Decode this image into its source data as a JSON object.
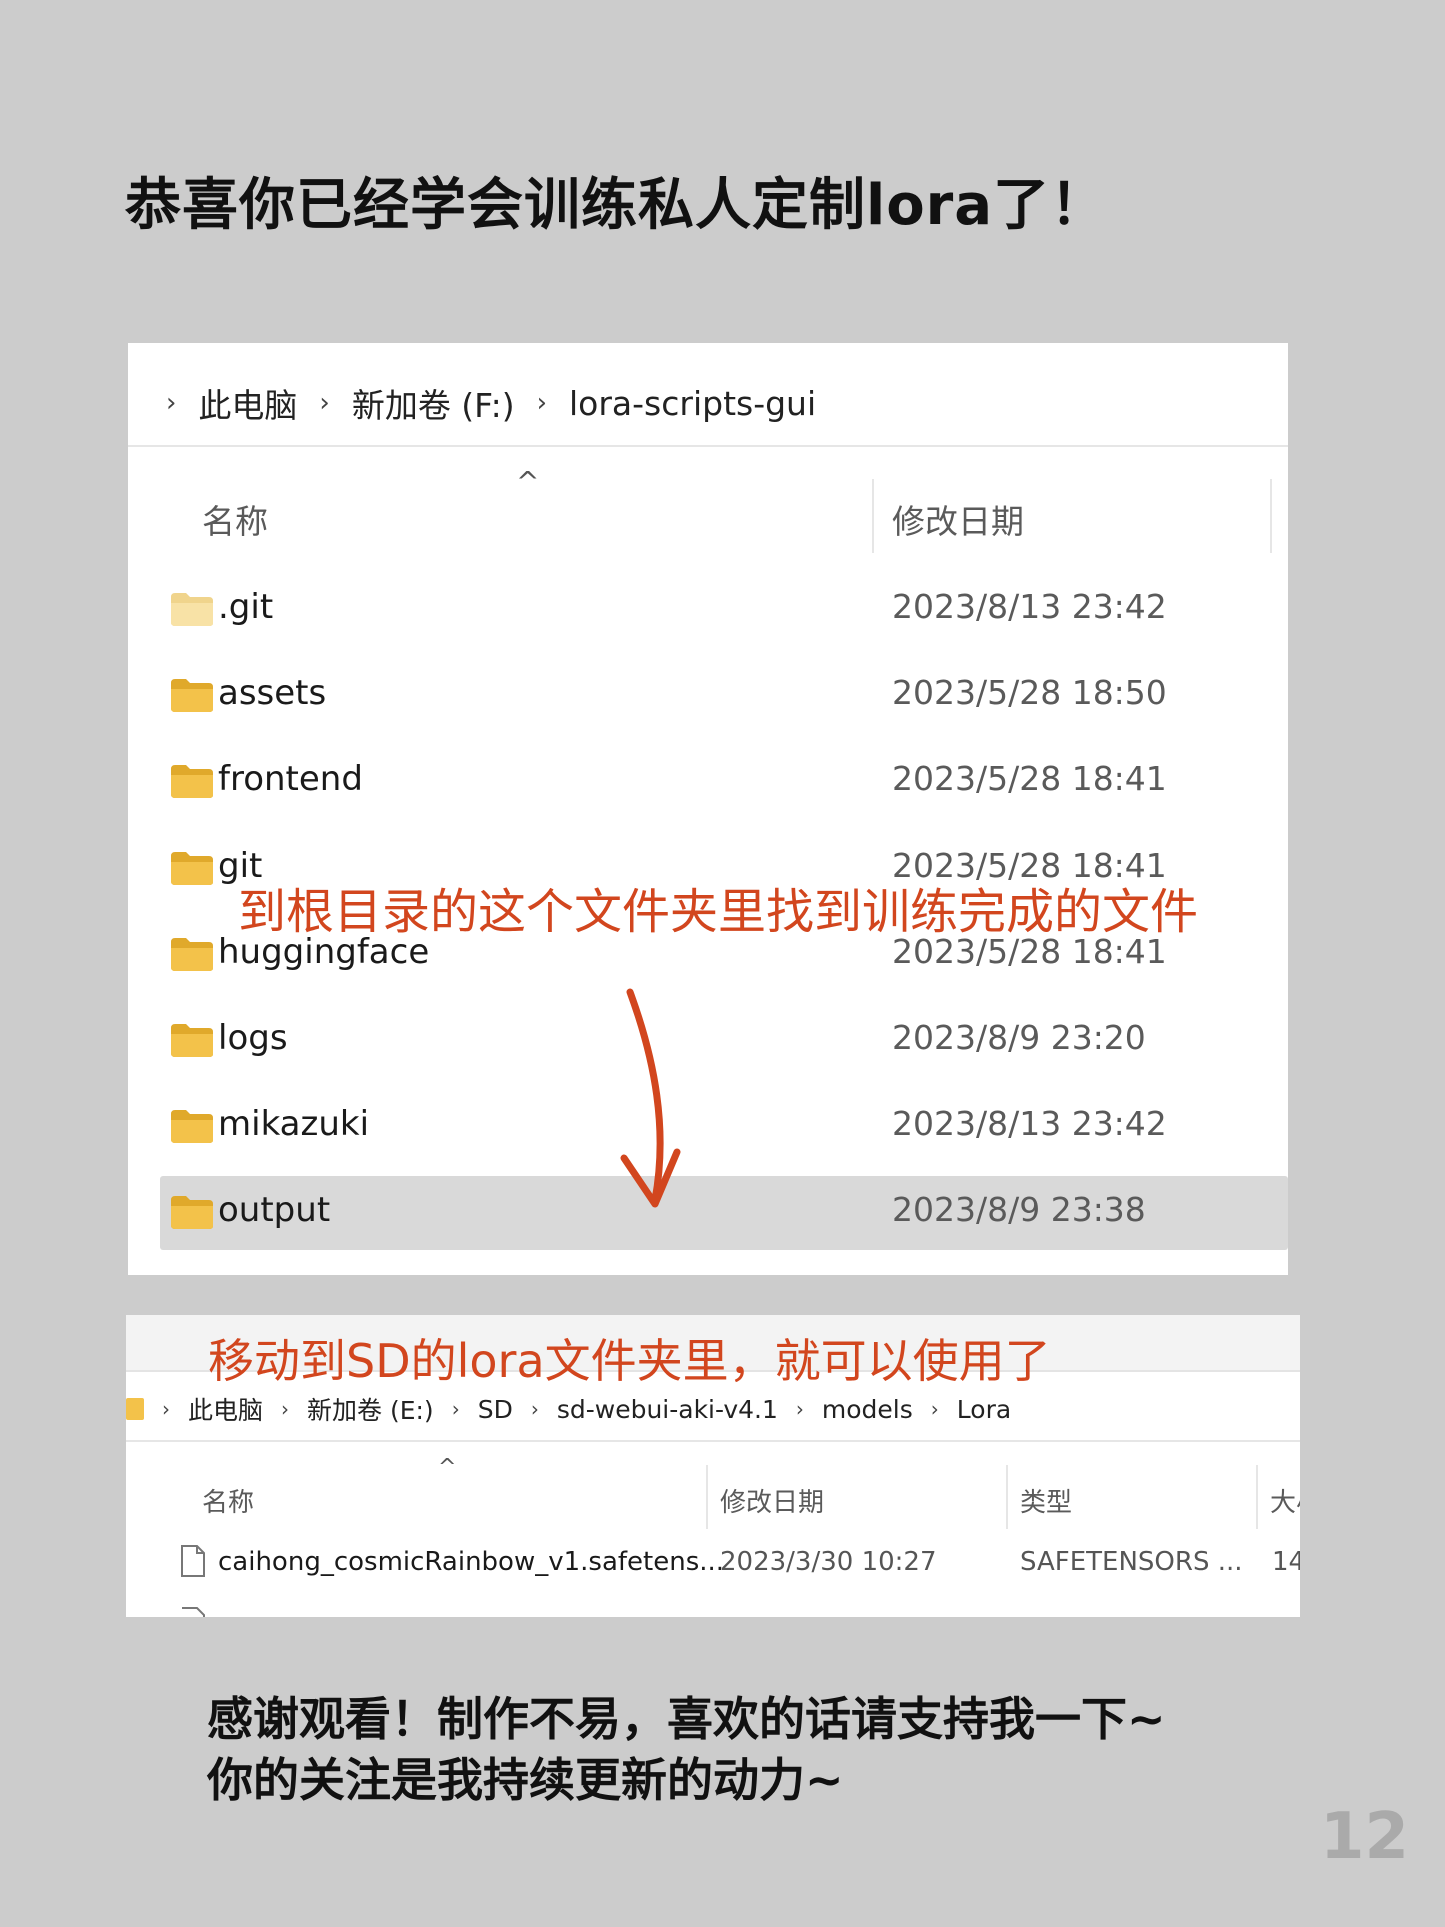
{
  "title": "恭喜你已经学会训练私人定制lora了！",
  "explorer1": {
    "breadcrumb": [
      "此电脑",
      "新加卷 (F:)",
      "lora-scripts-gui"
    ],
    "columns": {
      "name": "名称",
      "modified": "修改日期"
    },
    "rows": [
      {
        "name": ".git",
        "date": "2023/8/13 23:42",
        "selected": false,
        "faded": true
      },
      {
        "name": "assets",
        "date": "2023/5/28 18:50",
        "selected": false,
        "faded": false
      },
      {
        "name": "frontend",
        "date": "2023/5/28 18:41",
        "selected": false,
        "faded": false
      },
      {
        "name": "git",
        "date": "2023/5/28 18:41",
        "selected": false,
        "faded": false
      },
      {
        "name": "huggingface",
        "date": "2023/5/28 18:41",
        "selected": false,
        "faded": false
      },
      {
        "name": "logs",
        "date": "2023/8/9 23:20",
        "selected": false,
        "faded": false
      },
      {
        "name": "mikazuki",
        "date": "2023/8/13 23:42",
        "selected": false,
        "faded": false
      },
      {
        "name": "output",
        "date": "2023/8/9 23:38",
        "selected": true,
        "faded": false
      }
    ]
  },
  "annotation1": "到根目录的这个文件夹里找到训练完成的文件",
  "annotation2": "移动到SD的lora文件夹里，就可以使用了",
  "explorer2": {
    "breadcrumb": [
      "此电脑",
      "新加卷 (E:)",
      "SD",
      "sd-webui-aki-v4.1",
      "models",
      "Lora"
    ],
    "columns": {
      "name": "名称",
      "modified": "修改日期",
      "type": "类型",
      "size": "大小"
    },
    "rows": [
      {
        "name": "caihong_cosmicRainbow_v1.safetens...",
        "date": "2023/3/30 10:27",
        "type": "SAFETENSORS ...",
        "size": "14"
      }
    ]
  },
  "thanks_line1": "感谢观看！制作不易，喜欢的话请支持我一下~",
  "thanks_line2": "你的关注是我持续更新的动力~",
  "page_number": "12",
  "colors": {
    "background": "#cccccc",
    "annotation": "#d2461e",
    "folder": "#f3c24a",
    "selected_row": "#d9d9d9"
  }
}
